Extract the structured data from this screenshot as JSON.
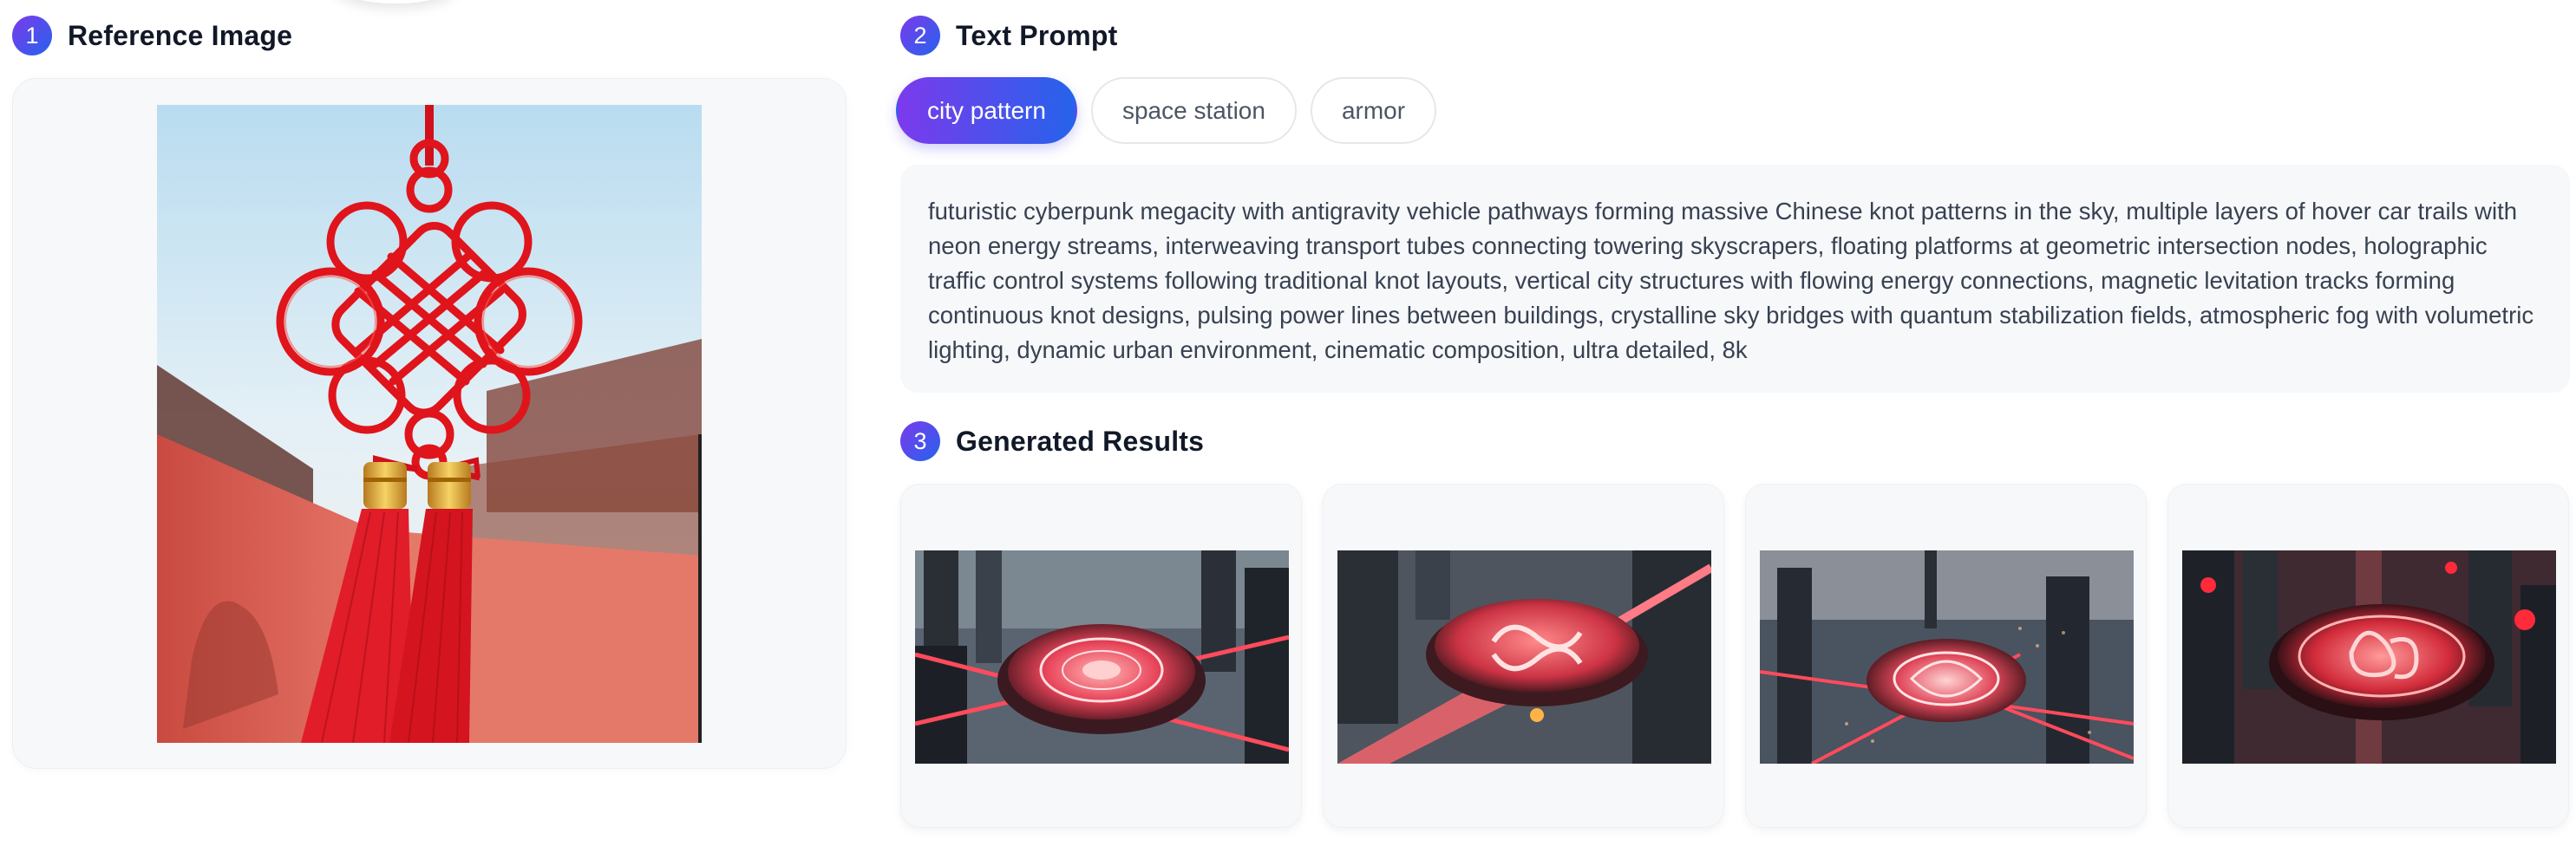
{
  "sections": {
    "reference": {
      "number": "1",
      "title": "Reference Image"
    },
    "prompt": {
      "number": "2",
      "title": "Text Prompt"
    },
    "results": {
      "number": "3",
      "title": "Generated Results"
    }
  },
  "tabs": [
    {
      "label": "city pattern",
      "active": true
    },
    {
      "label": "space station",
      "active": false
    },
    {
      "label": "armor",
      "active": false
    }
  ],
  "prompt_text": "futuristic cyberpunk megacity with antigravity vehicle pathways forming massive Chinese knot patterns in the sky, multiple layers of hover car trails with neon energy streams, interweaving transport tubes connecting towering skyscrapers, floating platforms at geometric intersection nodes, holographic traffic control systems following traditional knot layouts, vertical city structures with flowing energy connections, magnetic levitation tracks forming continuous knot designs, pulsing power lines between buildings, crystalline sky bridges with quantum stabilization fields, atmospheric fog with volumetric lighting, dynamic urban environment, cinematic composition, ultra detailed, 8k",
  "colors": {
    "accent_start": "#7c3aed",
    "accent_end": "#2563eb",
    "card_bg": "#f7f8fa",
    "knot_red": "#e0141b"
  }
}
